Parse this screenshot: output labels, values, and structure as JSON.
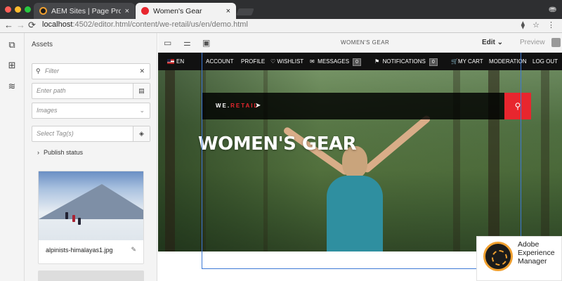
{
  "browser": {
    "tabs": [
      {
        "label": "AEM Sites | Page Properties",
        "active": false
      },
      {
        "label": "Women's Gear",
        "active": true
      }
    ],
    "url_host": "localhost",
    "url_rest": ":4502/editor.html/content/we-retail/us/en/demo.html",
    "user_icon": "⛂",
    "nav_back": "←",
    "nav_forward": "→",
    "reload": "⟳",
    "close_glyph": "×",
    "addr_right_icons": "⧫ ☆ ⋮"
  },
  "assets_panel": {
    "title": "Assets",
    "filter_placeholder": "Filter",
    "path_placeholder": "Enter path",
    "type_value": "Images",
    "tags_placeholder": "Select Tag(s)",
    "publish_status": "Publish status",
    "asset_name": "alpinists-himalayas1.jpg"
  },
  "editor_toolbar": {
    "page_title": "WOMEN'S GEAR",
    "mode": "Edit",
    "preview": "Preview"
  },
  "site_nav": {
    "lang": "EN",
    "items": [
      "ACCOUNT",
      "PROFILE",
      "WISHLIST",
      "MESSAGES",
      "NOTIFICATIONS",
      "MY CART",
      "MODERATION",
      "LOG OUT"
    ],
    "messages_count": "0",
    "notifications_count": "0"
  },
  "hero": {
    "logo_white": "WE.",
    "logo_red": "RETAIL",
    "title": "WOMEN'S GEAR"
  },
  "badge": {
    "line1": "Adobe",
    "line2": "Experience",
    "line3": "Manager"
  },
  "colors": {
    "accent_red": "#e8262e",
    "selection_blue": "#3d7ad6",
    "aem_orange": "#f0a030"
  }
}
